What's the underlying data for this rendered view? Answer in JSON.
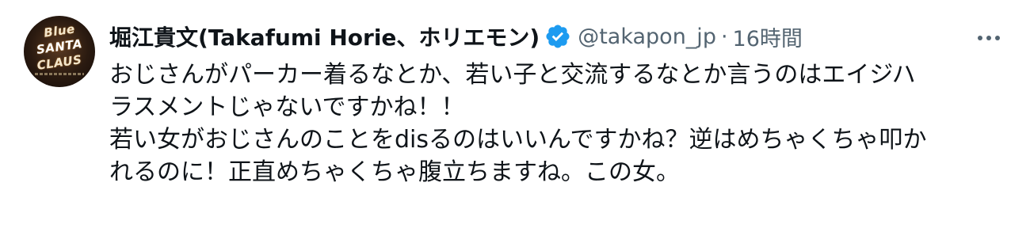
{
  "tweet": {
    "avatar": {
      "line1": "Blue",
      "line2": "SANTA",
      "line3": "CLAUS"
    },
    "author": {
      "display_name": "堀江貴文(Takafumi Horie、ホリエモン)",
      "handle": "@takapon_jp",
      "separator": "·",
      "time": "16時間"
    },
    "verified_color": "#1d9bf0",
    "more_icon": "more-horizontal-icon",
    "text_lines": [
      "おじさんがパーカー着るなとか、若い子と交流するなとか言うのはエイジハ",
      "ラスメントじゃないですかね！！",
      "若い女がおじさんのことをdisるのはいいんですかね？逆はめちゃくちゃ叩か",
      "れるのに！正直めちゃくちゃ腹立ちますね。この女。"
    ]
  }
}
